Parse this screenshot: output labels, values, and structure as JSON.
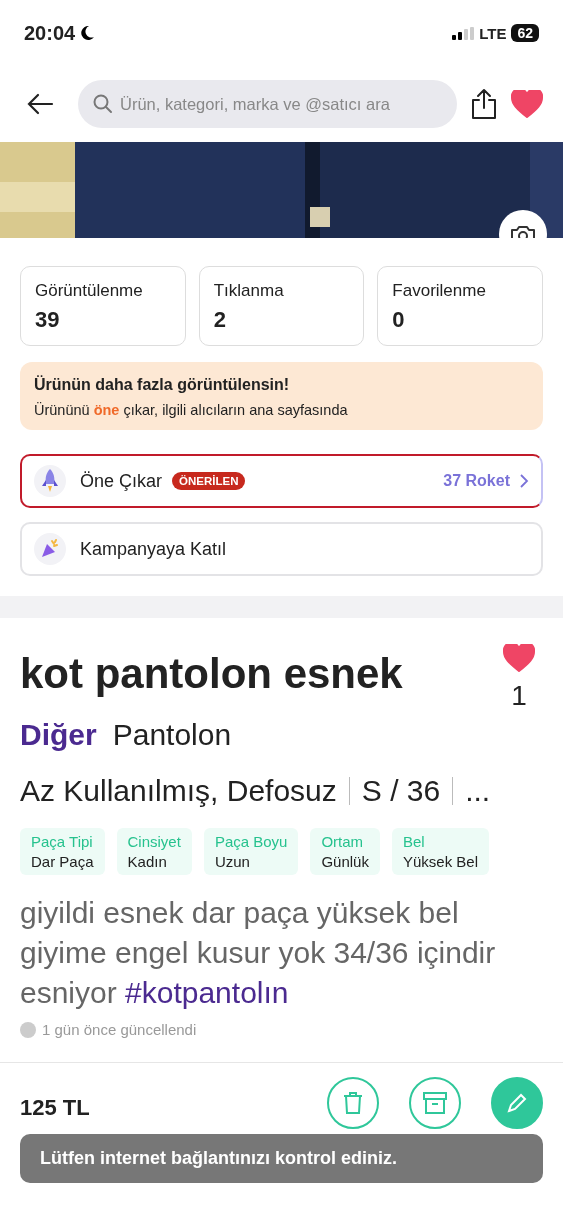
{
  "status_bar": {
    "time": "20:04",
    "network": "LTE",
    "battery": "62"
  },
  "nav": {
    "search": {
      "placeholder": "Ürün, kategori, marka ve @satıcı ara"
    },
    "favorite": true
  },
  "stats": [
    {
      "label": "Görüntülenme",
      "value": "39"
    },
    {
      "label": "Tıklanma",
      "value": "2"
    },
    {
      "label": "Favorilenme",
      "value": "0"
    }
  ],
  "promo": {
    "title": "Ürünün daha fazla görüntülensin!",
    "text": "Ürününü **öne** çıkar, ilgili alıcıların ana sayfasında"
  },
  "actions": [
    {
      "kind": "boost",
      "label": "Öne Çıkar",
      "badge": "ÖNERİLEN",
      "cost": "37 Roket"
    },
    {
      "kind": "campaign",
      "label": "Kampanyaya Katıl"
    }
  ],
  "product": {
    "title": "kot pantolon esnek",
    "likes": "1",
    "liked": true,
    "category": "Diğer",
    "subcategory": "Pantolon",
    "condition": "Az Kullanılmış, Defosuz",
    "size": "S / 36",
    "more": "...",
    "attributes": [
      {
        "name": "Paça Tipi",
        "value": "Dar Paça"
      },
      {
        "name": "Cinsiyet",
        "value": "Kadın"
      },
      {
        "name": "Paça Boyu",
        "value": "Uzun"
      },
      {
        "name": "Ortam",
        "value": "Günlük"
      },
      {
        "name": "Bel",
        "value": "Yüksek Bel"
      }
    ],
    "description": "giyildi esnek dar paça yüksek bel giyime engel kusur yok 34/36 içindir esniyor",
    "hashtag": "#kotpantolın",
    "updated": "1 gün önce güncellendi"
  },
  "bottom_bar": {
    "price": "125 TL",
    "buttons": [
      {
        "kind": "delete"
      },
      {
        "kind": "archive"
      },
      {
        "kind": "edit"
      }
    ]
  },
  "toast": "Lütfen internet bağlantınızı kontrol ediniz."
}
